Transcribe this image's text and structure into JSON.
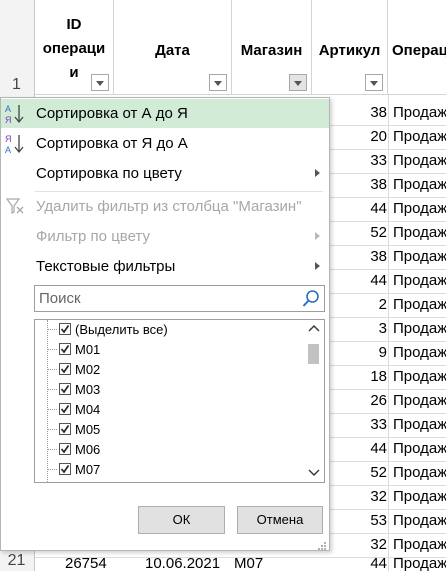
{
  "spreadsheet": {
    "headers": [
      {
        "lines": [
          "ID",
          "операци",
          "и"
        ]
      },
      {
        "lines": [
          "Дата"
        ]
      },
      {
        "lines": [
          "Магазин"
        ]
      },
      {
        "lines": [
          "Артикул"
        ]
      },
      {
        "lines": [
          "Операц"
        ]
      }
    ],
    "row_numbers": [
      "1",
      "21"
    ],
    "visible_rows": [
      {
        "articul": "38",
        "op": "Продаж"
      },
      {
        "articul": "20",
        "op": "Продаж"
      },
      {
        "articul": "33",
        "op": "Продаж"
      },
      {
        "articul": "38",
        "op": "Продаж"
      },
      {
        "articul": "44",
        "op": "Продаж"
      },
      {
        "articul": "52",
        "op": "Продаж"
      },
      {
        "articul": "38",
        "op": "Продаж"
      },
      {
        "articul": "44",
        "op": "Продаж"
      },
      {
        "articul": "2",
        "op": "Продаж"
      },
      {
        "articul": "3",
        "op": "Продаж"
      },
      {
        "articul": "9",
        "op": "Продаж"
      },
      {
        "articul": "18",
        "op": "Продаж"
      },
      {
        "articul": "26",
        "op": "Продаж"
      },
      {
        "articul": "33",
        "op": "Продаж"
      },
      {
        "articul": "44",
        "op": "Продаж"
      },
      {
        "articul": "52",
        "op": "Продаж"
      },
      {
        "articul": "32",
        "op": "Продаж"
      },
      {
        "articul": "53",
        "op": "Продаж"
      },
      {
        "articul": "32",
        "op": "Продаж"
      }
    ],
    "last_row": {
      "id": "26754",
      "date": "10.06.2021",
      "shop": "M07",
      "articul": "44",
      "op": "Продаж"
    }
  },
  "filter_menu": {
    "items": [
      {
        "label": "Сортировка от А до Я",
        "icon": "sort-az-icon",
        "state": "highlighted"
      },
      {
        "label": "Сортировка от Я до А",
        "icon": "sort-za-icon",
        "state": "normal"
      },
      {
        "label": "Сортировка по цвету",
        "state": "normal",
        "submenu": true
      },
      {
        "label": "Удалить фильтр из столбца \"Магазин\"",
        "icon": "clear-filter-icon",
        "state": "disabled"
      },
      {
        "label": "Фильтр по цвету",
        "state": "disabled",
        "submenu": true
      },
      {
        "label": "Текстовые фильтры",
        "state": "normal",
        "submenu": true
      }
    ],
    "search_placeholder": "Поиск",
    "list": [
      {
        "label": "(Выделить все)",
        "checked": true
      },
      {
        "label": "M01",
        "checked": true
      },
      {
        "label": "M02",
        "checked": true
      },
      {
        "label": "M03",
        "checked": true
      },
      {
        "label": "M04",
        "checked": true
      },
      {
        "label": "M05",
        "checked": true
      },
      {
        "label": "M06",
        "checked": true
      },
      {
        "label": "M07",
        "checked": true
      }
    ],
    "ok_label": "ОК",
    "cancel_label": "Отмена"
  },
  "colors": {
    "highlight": "#d1ebd7",
    "disabled_text": "#a7a7a7",
    "search_icon": "#2f6fc0"
  }
}
